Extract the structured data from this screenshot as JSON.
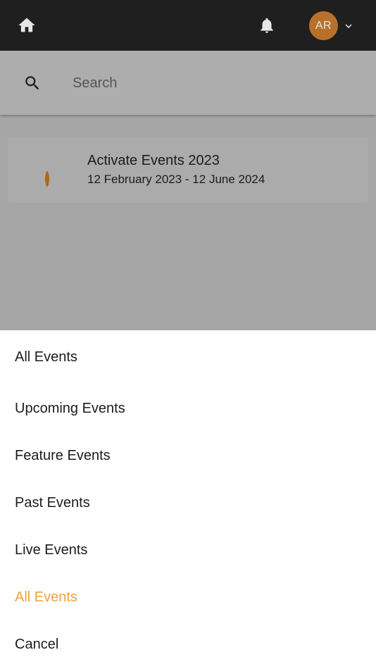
{
  "header": {
    "avatar_initials": "AR",
    "icons": [
      "home-icon",
      "bell-icon",
      "chevron-down-icon"
    ]
  },
  "search": {
    "placeholder": "Search"
  },
  "event": {
    "title": "Activate Events 2023",
    "dates": "12 February 2023 - 12 June 2024"
  },
  "sheet": {
    "header_label": "All Events",
    "options": [
      {
        "label": "Upcoming Events"
      },
      {
        "label": "Feature Events"
      },
      {
        "label": "Past Events"
      },
      {
        "label": "Live Events"
      },
      {
        "label": "All Events",
        "selected": true
      }
    ],
    "cancel_label": "Cancel"
  },
  "colors": {
    "topbar": "#1f1f1f",
    "avatar": "#b8712a",
    "accent": "#f0a040",
    "overlay": "#a6a6a6"
  }
}
